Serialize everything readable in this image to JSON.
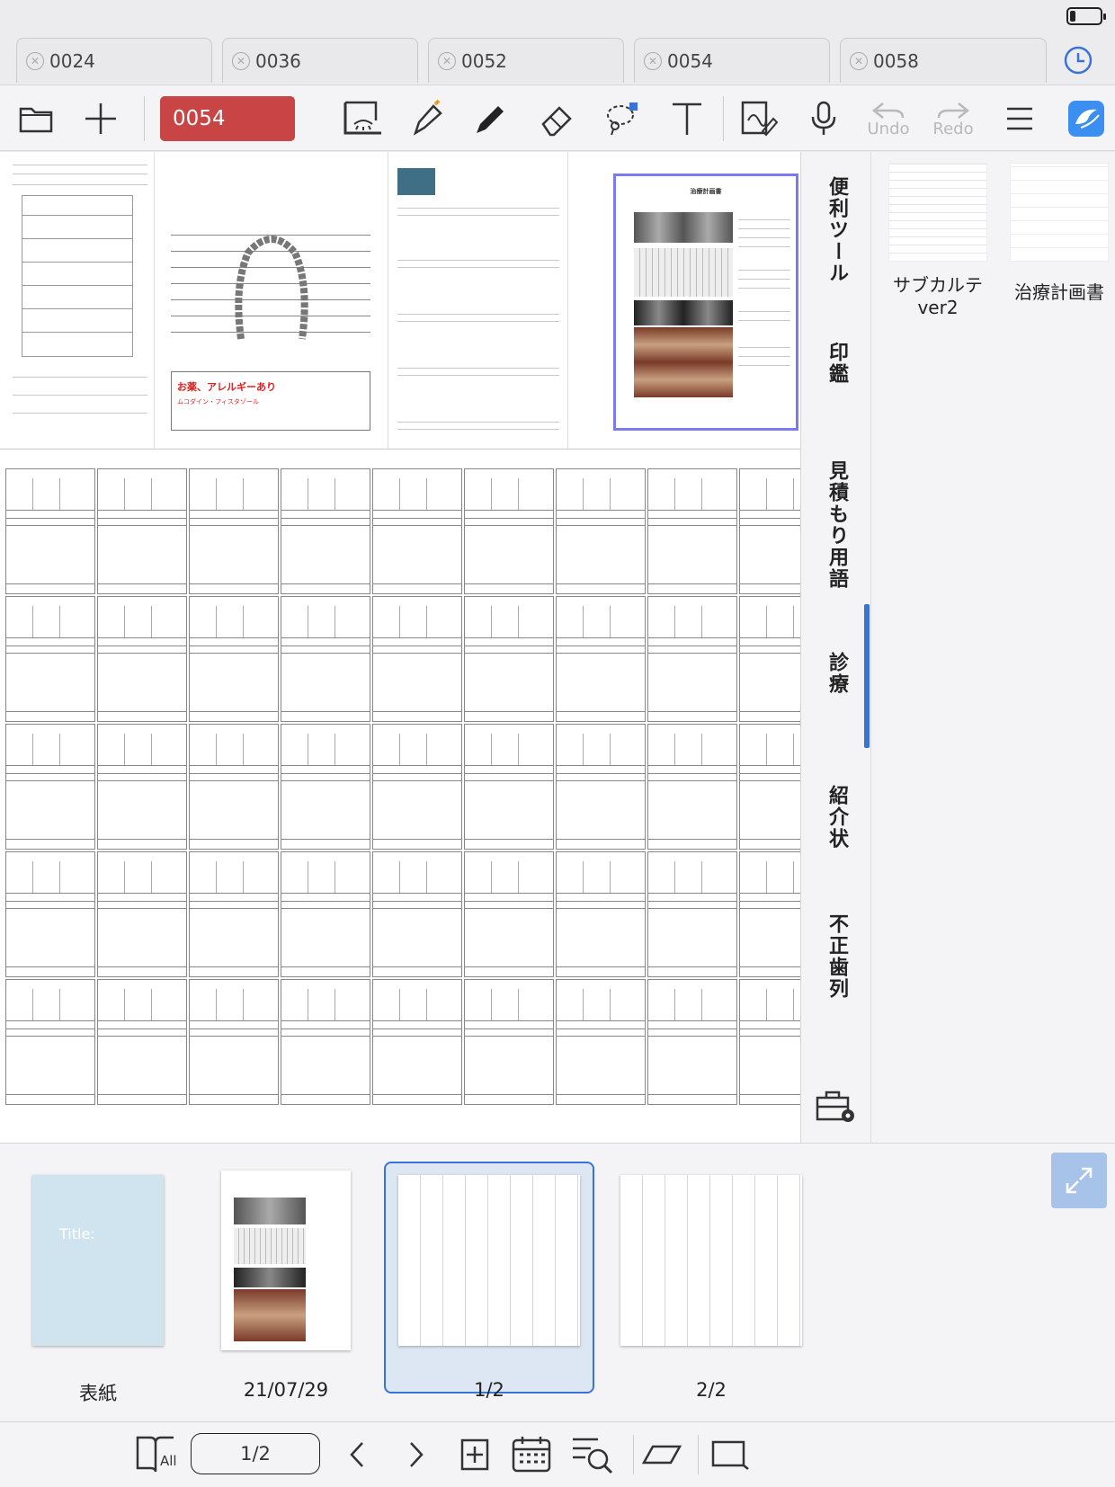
{
  "tabs": [
    {
      "label": "0024"
    },
    {
      "label": "0036"
    },
    {
      "label": "0052"
    },
    {
      "label": "0054"
    },
    {
      "label": "0058"
    }
  ],
  "battery_level": 0.2,
  "toolbar": {
    "doc_title": "0054",
    "undo_label": "Undo",
    "redo_label": "Redo"
  },
  "canvas": {
    "allergy_note": "お薬、アレルギーあり",
    "allergy_sub": "ムコダイン・フィスタゾール",
    "plan_title": "治療計画書"
  },
  "side_tabs": [
    "便利ツール",
    "印鑑",
    "見積もり用語",
    "診療",
    "紹介状",
    "不正歯列"
  ],
  "side_tab_active": "診療",
  "templates": [
    {
      "label_line1": "サブカルテ",
      "label_line2": "ver2"
    },
    {
      "label_line1": "治療計画書",
      "label_line2": ""
    }
  ],
  "pages": [
    {
      "label": "表紙",
      "cover_text": "Title:"
    },
    {
      "label": "21/07/29"
    },
    {
      "label": "1/2"
    },
    {
      "label": "2/2"
    }
  ],
  "bottombar": {
    "all_label": "All",
    "page_indicator": "1/2"
  },
  "colors": {
    "accent": "#3a73d8",
    "doc_title_bg": "#c94545",
    "allergy_red": "#e02020"
  }
}
